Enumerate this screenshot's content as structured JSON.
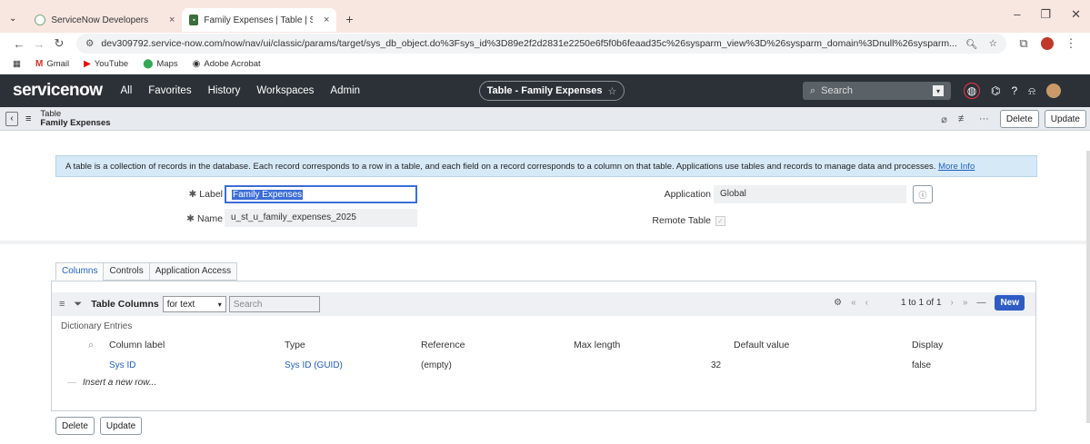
{
  "browser": {
    "tabs": [
      {
        "label": "ServiceNow Developers",
        "active": false
      },
      {
        "label": "Family Expenses | Table | Servic",
        "active": true
      }
    ],
    "new_tab": "+",
    "url": "dev309792.service-now.com/now/nav/ui/classic/params/target/sys_db_object.do%3Fsys_id%3D89e2f2d2831e2250e6f5f0b6feaad35c%26sysparm_view%3D%26sysparm_domain%3Dnull%26sysparm...",
    "bookmarks": [
      "Gmail",
      "YouTube",
      "Maps",
      "Adobe Acrobat"
    ]
  },
  "sn_header": {
    "logo": "servicenow",
    "menu": [
      "All",
      "Favorites",
      "History",
      "Workspaces",
      "Admin"
    ],
    "context": "Table - Family Expenses",
    "search_placeholder": "Search"
  },
  "form_header": {
    "line1": "Table",
    "line2": "Family Expenses",
    "delete": "Delete",
    "update": "Update"
  },
  "info": {
    "text": "A table is a collection of records in the database. Each record corresponds to a row in a table, and each field on a record corresponds to a column on that table. Applications use tables and records to manage data and processes.",
    "link": "More Info"
  },
  "fields": {
    "label_label": "Label",
    "label_value": "Family Expenses",
    "name_label": "Name",
    "name_value": "u_st_u_family_expenses_2025",
    "application_label": "Application",
    "application_value": "Global",
    "remote_label": "Remote Table"
  },
  "tabs": [
    "Columns",
    "Controls",
    "Application Access"
  ],
  "list": {
    "title": "Table Columns",
    "filter_select": "for text",
    "search_placeholder": "Search",
    "pager": "1 to 1 of 1",
    "new": "New",
    "section": "Dictionary Entries",
    "columns": [
      "Column label",
      "Type",
      "Reference",
      "Max length",
      "Default value",
      "Display"
    ],
    "row": {
      "label": "Sys ID",
      "type": "Sys ID (GUID)",
      "reference": "(empty)",
      "max_length": "32",
      "default": "",
      "display": "false"
    },
    "insert": "Insert a new row..."
  },
  "bottom": {
    "delete": "Delete",
    "update": "Update"
  }
}
